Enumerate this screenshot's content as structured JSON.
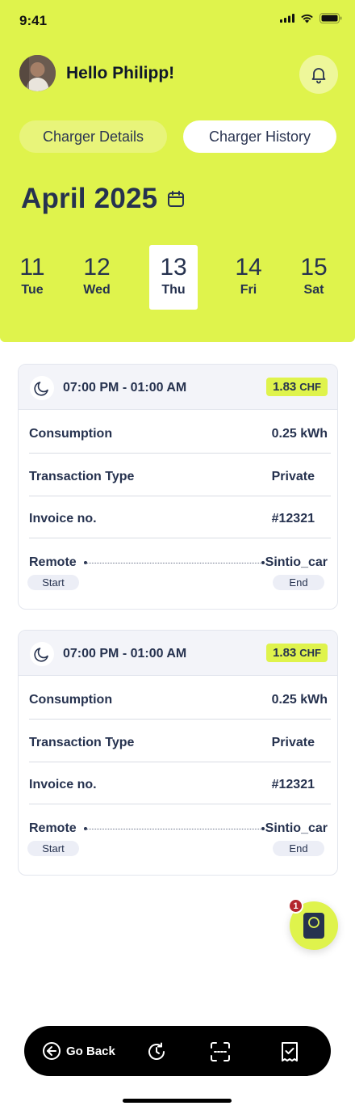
{
  "status": {
    "time": "9:41"
  },
  "header": {
    "greeting": "Hello Philipp!",
    "tabs": [
      {
        "label": "Charger Details",
        "active": false
      },
      {
        "label": "Charger History",
        "active": true
      }
    ],
    "month": "April 2025",
    "days": [
      {
        "num": "11",
        "name": "Tue",
        "selected": false
      },
      {
        "num": "12",
        "name": "Wed",
        "selected": false
      },
      {
        "num": "13",
        "name": "Thu",
        "selected": true
      },
      {
        "num": "14",
        "name": "Fri",
        "selected": false
      },
      {
        "num": "15",
        "name": "Sat",
        "selected": false
      }
    ]
  },
  "sessions": [
    {
      "time_range": "07:00 PM - 01:00 AM",
      "amount": "1.83",
      "currency": "CHF",
      "consumption_label": "Consumption",
      "consumption": "0.25 kWh",
      "type_label": "Transaction Type",
      "type": "Private",
      "invoice_label": "Invoice no.",
      "invoice": "#12321",
      "from": "Remote",
      "to": "Sintio_car",
      "start_label": "Start",
      "end_label": "End"
    },
    {
      "time_range": "07:00 PM - 01:00 AM",
      "amount": "1.83",
      "currency": "CHF",
      "consumption_label": "Consumption",
      "consumption": "0.25 kWh",
      "type_label": "Transaction Type",
      "type": "Private",
      "invoice_label": "Invoice no.",
      "invoice": "#12321",
      "from": "Remote",
      "to": "Sintio_car",
      "start_label": "Start",
      "end_label": "End"
    }
  ],
  "fab": {
    "badge": "1"
  },
  "nav": {
    "back_label": "Go Back"
  },
  "colors": {
    "accent": "#dff34c",
    "text": "#26324f",
    "nav": "#000000",
    "badge": "#b3262d"
  }
}
